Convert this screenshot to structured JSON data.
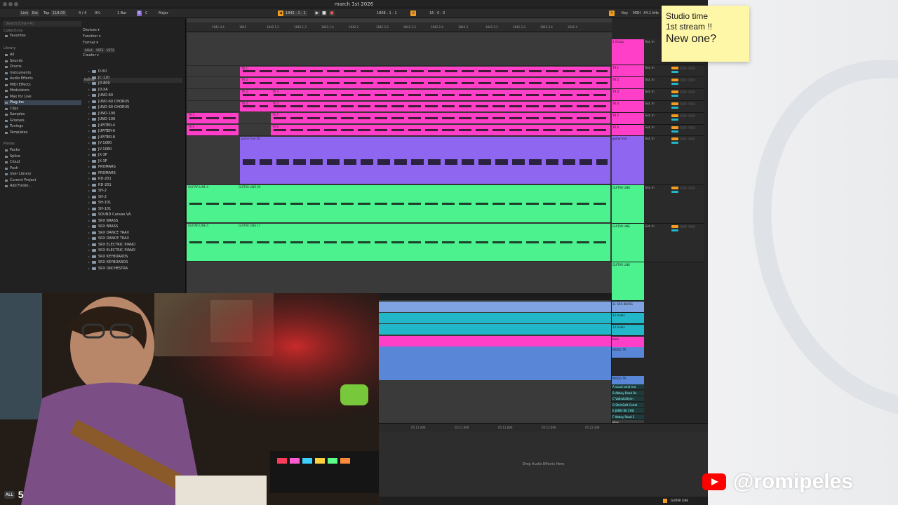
{
  "window": {
    "title": "march 1st 2026"
  },
  "control": {
    "link": "Link",
    "ext": "Ext",
    "tap": "Tap",
    "tempo": "118.00",
    "signature": "4 / 4",
    "groove": "0%",
    "quantize": "1 Bar",
    "scale_icon": "S",
    "key": "C",
    "mode": "Major",
    "follow": "◀",
    "position": "1842 . 1 . 1",
    "loop_start": "1808 . 1 . 1",
    "loop": "⟲",
    "loop_length": "16 . 0 . 0",
    "draw": "✎",
    "keymap": "Key",
    "midi": "MIDI",
    "sample_rate": "44.1 kHz"
  },
  "browser": {
    "search_placeholder": "Search (Cmd + F)",
    "collections_label": "Collections",
    "favorites": "Favorites",
    "library_label": "Library",
    "library": [
      "All",
      "Sounds",
      "Drums",
      "Instruments",
      "Audio Effects",
      "MIDI Effects",
      "Modulators",
      "Max for Live",
      "Plug-Ins",
      "Clips",
      "Samples",
      "Grooves",
      "Tunings",
      "Templates"
    ],
    "library_selected": 8,
    "places_label": "Places",
    "places": [
      "Packs",
      "Splice",
      "Cloud",
      "Push",
      "User Library",
      "Current Project",
      "Add Folder..."
    ],
    "filters": [
      "Devices ▾",
      "Function ▾",
      "Format ▾",
      "Creator ▾"
    ],
    "formats": [
      "AUv3",
      "VST2",
      "VST3"
    ],
    "name_header": "Name",
    "files": [
      "D-50",
      "JD-800",
      "JUNO-106",
      "JUPITER-8",
      "JV-1080",
      "SH-101",
      "TR-808",
      "TR-909",
      "JX-8P",
      "SRX BRASS",
      "SRX DANCE TRAX",
      "SRX ELECTRIC PIANO",
      "SRX KEYBOARDS",
      "SRX ORCHESTRA"
    ],
    "file_rows": [
      "D-50",
      "JC-120",
      "JD-800",
      "JD-XA",
      "JUNO-60",
      "JUNO-60 CHORUS",
      "JUNO-60 CHORUS",
      "JUNO-106",
      "JUNO-106",
      "JUPITER-4",
      "JUPITER-6",
      "JUPITER-8",
      "JV-1080",
      "JV-1080",
      "JX-3P",
      "JX-3P",
      "PROMARS",
      "PROMARS",
      "RD-201",
      "RD-201",
      "SH-2",
      "SH-2",
      "SH-101",
      "SH-101",
      "SOUND Canvas VA",
      "SRX BRASS",
      "SRX BRASS",
      "SRX DANCE TRAX",
      "SRX DANCE TRAX",
      "SRX ELECTRIC PIANO",
      "SRX ELECTRIC PIANO",
      "SRX KEYBOARDS",
      "SRX KEYBOARDS",
      "SRX ORCHESTRA"
    ]
  },
  "ruler": [
    "1841.4.4",
    "1842",
    "1842.1.2",
    "1842.1.3",
    "1842.1.4",
    "1842.2",
    "1842.2.2",
    "1842.2.3",
    "1842.2.4",
    "1842.3",
    "1842.3.2",
    "1842.3.3",
    "1842.3.4",
    "1842.4"
  ],
  "tracks": [
    {
      "name": "1 Group",
      "color": "#ff3fc8",
      "clips": [],
      "height": "group"
    },
    {
      "name": "TR 1",
      "color": "#ff3fc8",
      "clips": [
        "TR 1"
      ]
    },
    {
      "name": "TR 2",
      "color": "#ff3fc8",
      "clips": [
        "TR 2"
      ]
    },
    {
      "name": "TR 3",
      "color": "#ff3fc8",
      "clips": [
        "TR 3",
        "TR 3"
      ]
    },
    {
      "name": "TR 4",
      "color": "#ff3fc8",
      "clips": [
        "TR 4",
        "TR 4"
      ]
    },
    {
      "name": "TR 5",
      "color": "#ff3fc8",
      "clips": [
        "TR 5",
        "TR 5"
      ]
    },
    {
      "name": "TR 6",
      "color": "#ff3fc8",
      "clips": [
        "TR 6",
        "TR 6"
      ]
    },
    {
      "name": "guitar line",
      "color": "#8f66f0",
      "clips": [
        "guitar line 26"
      ]
    },
    {
      "name": "GUITAR LINE",
      "color": "#4cf28e",
      "clips": [
        "GUITAR LINE 4",
        "GUITAR LINE 20"
      ]
    },
    {
      "name": "GUITAR LINE",
      "color": "#4cf28e",
      "clips": [
        "GUITAR LINE 4",
        "GUITAR LINE 17"
      ]
    }
  ],
  "lower_tracks": [
    {
      "name": "11 SRX BRASS",
      "color": "#7fa3e0"
    },
    {
      "name": "12 Audio",
      "color": "#22b7c8"
    },
    {
      "name": "13 Audio",
      "color": "#22b7c8"
    },
    {
      "name": "bass",
      "color": "#ff3fc8"
    },
    {
      "name": "MOOG TR",
      "color": "#5a86d8"
    },
    {
      "name": "MOOG TR",
      "color": "#5a86d8"
    }
  ],
  "returns": [
    "A vocal send ma",
    "B Abbey Road Re",
    "C ValhallaShim",
    "D ShimSoft Comb",
    "E JUNO-60 CHO",
    "F Abbey Road 2"
  ],
  "master": "Main",
  "mixer": {
    "input": "Ext. In",
    "out": "Main",
    "monitor_in": "In",
    "monitor_auto": "Auto",
    "monitor_off": "Off"
  },
  "timebar": [
    "05:11.400",
    "05:11.600",
    "05:11.800",
    "05:12.000",
    "05:12.200"
  ],
  "device": {
    "drop_hint": "Drop Audio Effects Here"
  },
  "status": {
    "selected_track": "GUITAR LINE"
  },
  "sticky": {
    "line1": "Studio time",
    "line2": "1st stream !!",
    "line3": "New one?"
  },
  "overlay": {
    "handle": "@romipeles",
    "badge": "ALL",
    "count": "5"
  },
  "colors": {
    "orange": "#f39c22",
    "pink": "#ff3fc8",
    "purple": "#8f66f0",
    "green": "#4cf28e",
    "teal": "#22b7c8",
    "blue": "#5a86d8"
  }
}
